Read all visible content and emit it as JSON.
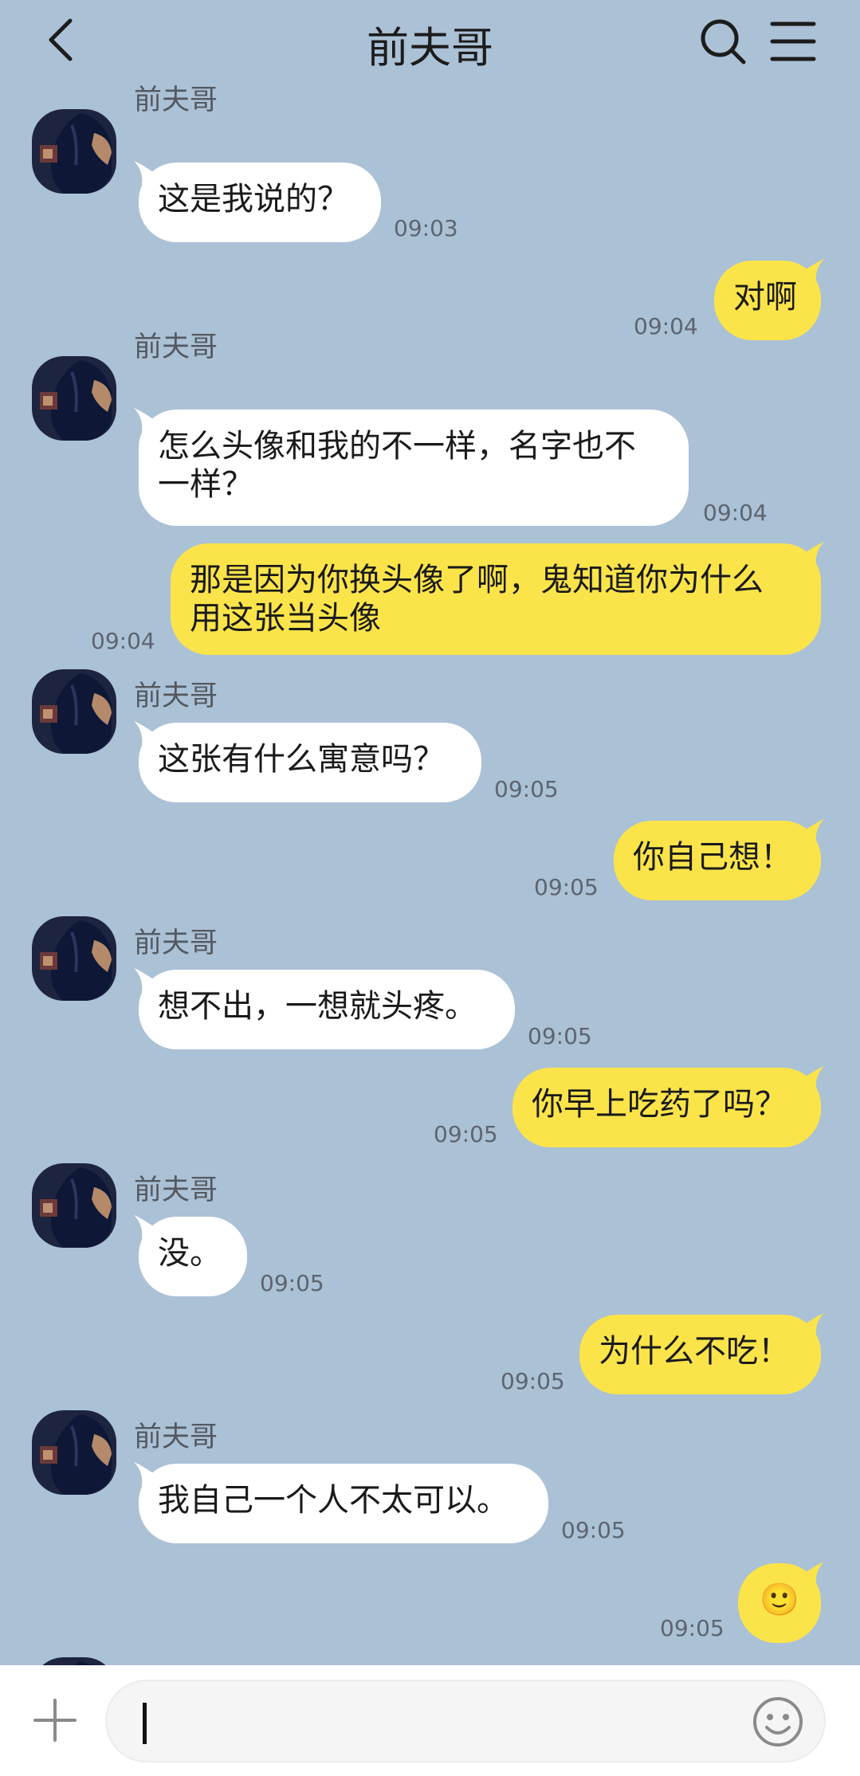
{
  "header": {
    "title": "前夫哥",
    "back_icon": "chevron-left-icon",
    "search_icon": "search-icon",
    "menu_icon": "hamburger-menu-icon"
  },
  "contact": {
    "name": "前夫哥",
    "avatar_icon": "avatar-image"
  },
  "messages": [
    {
      "side": "in",
      "sender": "前夫哥",
      "text": "这是我说的？",
      "time": "09:03"
    },
    {
      "side": "out",
      "text": "对啊",
      "time": "09:04"
    },
    {
      "side": "in",
      "sender": "前夫哥",
      "text": "怎么头像和我的不一样，名字也不一样？",
      "lines": [
        "怎么头像和我的不一样，名字也不",
        "一样？"
      ],
      "time": "09:04"
    },
    {
      "side": "out",
      "text": "那是因为你换头像了啊，鬼知道你为什么用这张当头像",
      "lines": [
        "那是因为你换头像了啊，鬼知道你为什么",
        "用这张当头像"
      ],
      "time": "09:04"
    },
    {
      "side": "in",
      "sender": "前夫哥",
      "text": "这张有什么寓意吗？",
      "time": "09:05"
    },
    {
      "side": "out",
      "text": "你自己想！",
      "time": "09:05"
    },
    {
      "side": "in",
      "sender": "前夫哥",
      "text": "想不出，一想就头疼。",
      "time": "09:05"
    },
    {
      "side": "out",
      "text": "你早上吃药了吗？",
      "time": "09:05"
    },
    {
      "side": "in",
      "sender": "前夫哥",
      "text": "没。",
      "time": "09:05"
    },
    {
      "side": "out",
      "text": "为什么不吃！",
      "time": "09:05"
    },
    {
      "side": "in",
      "sender": "前夫哥",
      "text": "我自己一个人不太可以。",
      "time": "09:05"
    },
    {
      "side": "out",
      "text": "🙂",
      "time": "09:05"
    }
  ],
  "input_bar": {
    "plus_icon": "plus-icon",
    "input_value": "",
    "emoji_icon": "emoji-smiley-icon"
  },
  "colors": {
    "chat_background": "#abc1d6",
    "incoming_bubble": "#ffffff",
    "outgoing_bubble": "#fbe44a"
  }
}
